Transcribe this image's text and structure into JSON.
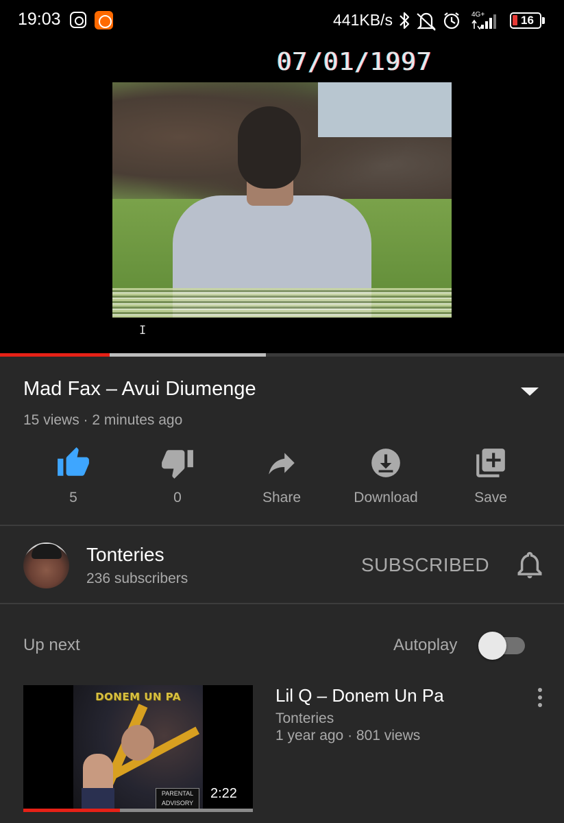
{
  "status_bar": {
    "time": "19:03",
    "speed": "441KB/s",
    "network": "4G+",
    "battery": "16",
    "icons": [
      "instagram-icon",
      "mi-icon",
      "bluetooth-icon",
      "mute-icon",
      "alarm-icon",
      "signal-icon",
      "battery-icon"
    ]
  },
  "player": {
    "overlay_date": "07/01/1997",
    "cursor_char": "I",
    "progress_played": 0.195,
    "progress_buffered": 0.472,
    "colors": {
      "played": "#e62117",
      "buffered": "#bdbdbd"
    }
  },
  "video": {
    "title": "Mad Fax – Avui Diumenge",
    "meta": "15 views · 2 minutes ago"
  },
  "actions": [
    {
      "icon": "thumbs-up-icon",
      "label": "5",
      "active": true,
      "color": "#3ea6ff"
    },
    {
      "icon": "thumbs-down-icon",
      "label": "0",
      "active": false,
      "color": "#aaaaaa"
    },
    {
      "icon": "share-icon",
      "label": "Share",
      "active": false,
      "color": "#aaaaaa"
    },
    {
      "icon": "download-icon",
      "label": "Download",
      "active": false,
      "color": "#aaaaaa"
    },
    {
      "icon": "add-to-playlist-icon",
      "label": "Save",
      "active": false,
      "color": "#aaaaaa"
    }
  ],
  "channel": {
    "name": "Tonteries",
    "subscribers": "236 subscribers",
    "subscribe_state": "SUBSCRIBED"
  },
  "up_next": {
    "label": "Up next",
    "autoplay_label": "Autoplay",
    "autoplay_on": false,
    "item": {
      "title": "Lil Q – Donem Un Pa",
      "channel": "Tonteries",
      "meta": "1 year ago · 801 views",
      "duration": "2:22",
      "thumb_text": "DONEM UN PA",
      "advisory_text": "PARENTAL ADVISORY",
      "watched_fraction": 0.42
    }
  }
}
